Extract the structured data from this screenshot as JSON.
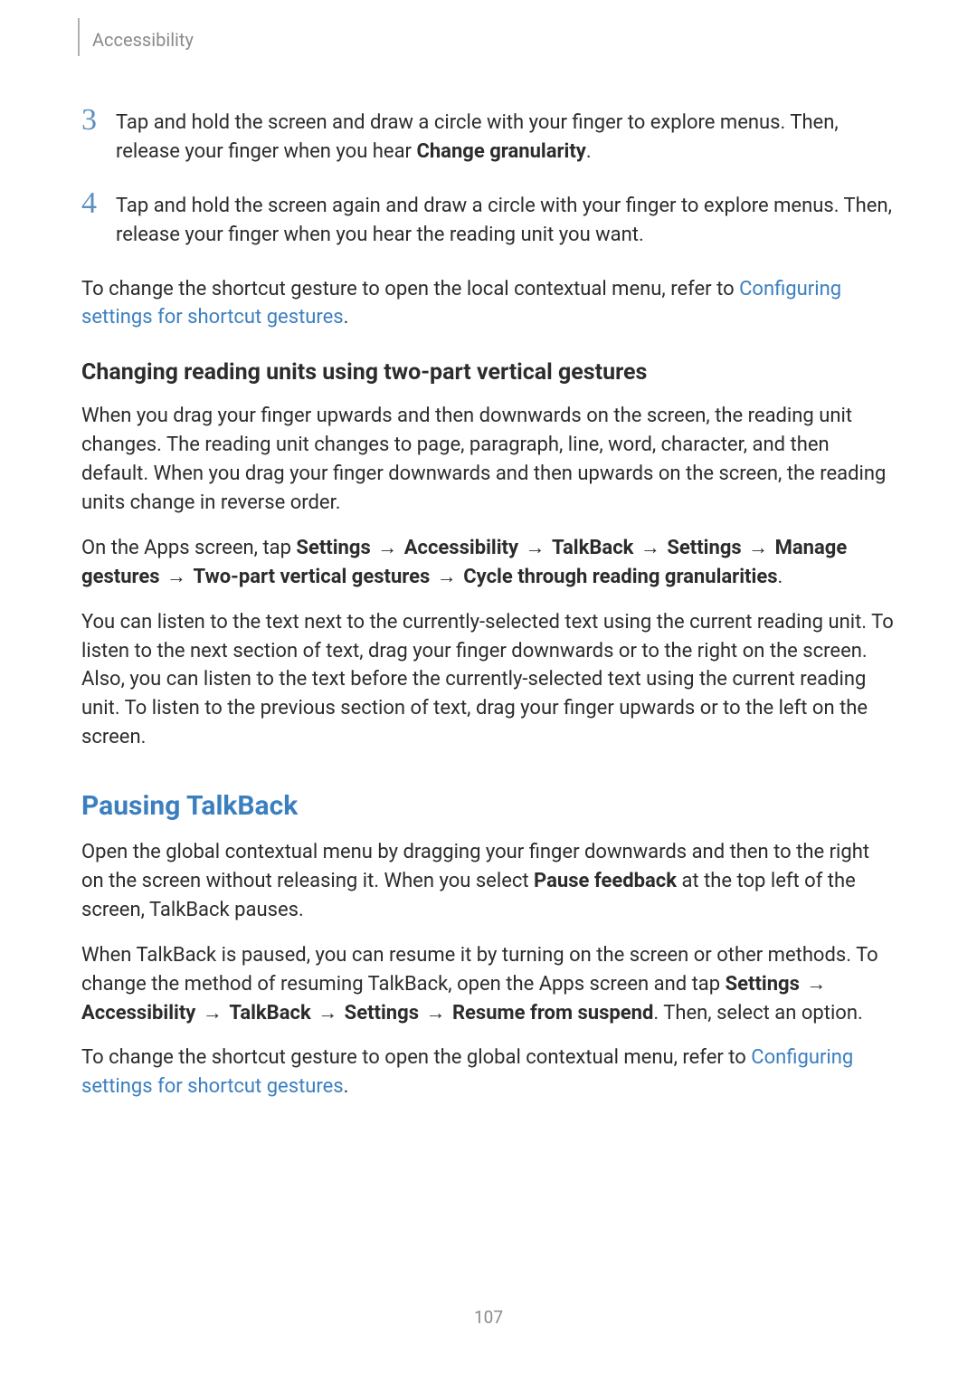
{
  "header": {
    "section": "Accessibility"
  },
  "steps": {
    "s3": {
      "num": "3",
      "text_a": "Tap and hold the screen and draw a circle with your finger to explore menus. Then, release your finger when you hear ",
      "bold_a": "Change granularity",
      "text_b": "."
    },
    "s4": {
      "num": "4",
      "text": "Tap and hold the screen again and draw a circle with your finger to explore menus. Then, release your finger when you hear the reading unit you want."
    }
  },
  "para1": {
    "a": "To change the shortcut gesture to open the local contextual menu, refer to ",
    "link": "Configuring settings for shortcut gestures",
    "b": "."
  },
  "h3_1": "Changing reading units using two-part vertical gestures",
  "para2": "When you drag your finger upwards and then downwards on the screen, the reading unit changes. The reading unit changes to page, paragraph, line, word, character, and then default. When you drag your finger downwards and then upwards on the screen, the reading units change in reverse order.",
  "para3": {
    "a": "On the Apps screen, tap ",
    "b1": "Settings",
    "arr": "→",
    "b2": "Accessibility",
    "b3": "TalkBack",
    "b4": "Settings",
    "b5": "Manage gestures",
    "b6": "Two-part vertical gestures",
    "b7": "Cycle through reading granularities",
    "z": "."
  },
  "para4": "You can listen to the text next to the currently-selected text using the current reading unit. To listen to the next section of text, drag your finger downwards or to the right on the screen. Also, you can listen to the text before the currently-selected text using the current reading unit. To listen to the previous section of text, drag your finger upwards or to the left on the screen.",
  "h2_1": "Pausing TalkBack",
  "para5": {
    "a": "Open the global contextual menu by dragging your finger downwards and then to the right on the screen without releasing it. When you select ",
    "bold": "Pause feedback",
    "b": " at the top left of the screen, TalkBack pauses."
  },
  "para6": {
    "a": "When TalkBack is paused, you can resume it by turning on the screen or other methods. To change the method of resuming TalkBack, open the Apps screen and tap ",
    "b1": "Settings",
    "arr": "→",
    "b2": "Accessibility",
    "b3": "TalkBack",
    "b4": "Settings",
    "b5": "Resume from suspend",
    "b": ". Then, select an option."
  },
  "para7": {
    "a": "To change the shortcut gesture to open the global contextual menu, refer to ",
    "link": "Configuring settings for shortcut gestures",
    "b": "."
  },
  "pagenum": "107"
}
